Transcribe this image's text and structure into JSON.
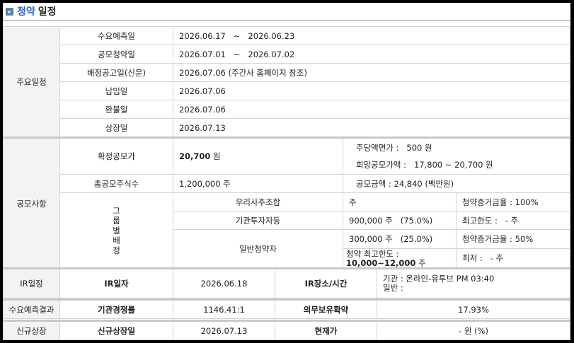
{
  "header": {
    "title_part1": "청약",
    "title_part2": "일정"
  },
  "schedule": {
    "category": "주요일정",
    "rows": [
      {
        "label": "수요예측일",
        "value": "2026.06.17   ~   2026.06.23"
      },
      {
        "label": "공모청약일",
        "value": "2026.07.01   ~   2026.07.02"
      },
      {
        "label": "배정공고일(신문)",
        "value": "2026.07.06 (주간사 홈페이지 참조)"
      },
      {
        "label": "납입일",
        "value": "2026.07.06"
      },
      {
        "label": "환불일",
        "value": "2026.07.06"
      },
      {
        "label": "상장일",
        "value": "2026.07.13"
      }
    ]
  },
  "offering": {
    "category": "공모사항",
    "fixed_price_label": "확정공모가",
    "fixed_price_value": "20,700",
    "fixed_price_unit": "원",
    "par_value": "주당액면가 :   500 원",
    "hope_price": "희망공모가액 :   17,800 ~ 20,700 원",
    "total_shares_label": "총공모주식수",
    "total_shares_value": "1,200,000 주",
    "amount": "공모금액 : 24,840 (백만원)",
    "group_label": "그룹별배정",
    "employee_label": "우리사주조합",
    "employee_shares": "주",
    "employee_rate": "청약증거금율 : 100%",
    "inst_label": "기관투자자등",
    "inst_shares": "900,000 주   (75.0%)",
    "inst_limit": "최고한도 :   - 주",
    "general_label": "일반청약자",
    "general_shares": "300,000 주   (25.0%)",
    "general_rate": "청약증거금율 : 50%",
    "general_max_label": "청약 최고한도 :",
    "general_max_value": "10,000~12,000",
    "general_max_unit": "주",
    "general_min": "최저 :   - 주"
  },
  "ir": {
    "category": "IR일정",
    "date_label": "IR일자",
    "date_value": "2026.06.18",
    "place_label": "IR장소/시간",
    "inst": "기관 : 온라인-유투브 PM 03:40",
    "general": "일반 :"
  },
  "demand": {
    "category": "수요예측결과",
    "comp_label": "기관경쟁률",
    "comp_value": "1146.41:1",
    "lock_label": "의무보유확약",
    "lock_value": "17.93%"
  },
  "listing": {
    "category": "신규상장",
    "date_label": "신규상장일",
    "date_value": "2026.07.13",
    "price_label": "현재가",
    "price_value": "- 원 (%)"
  }
}
